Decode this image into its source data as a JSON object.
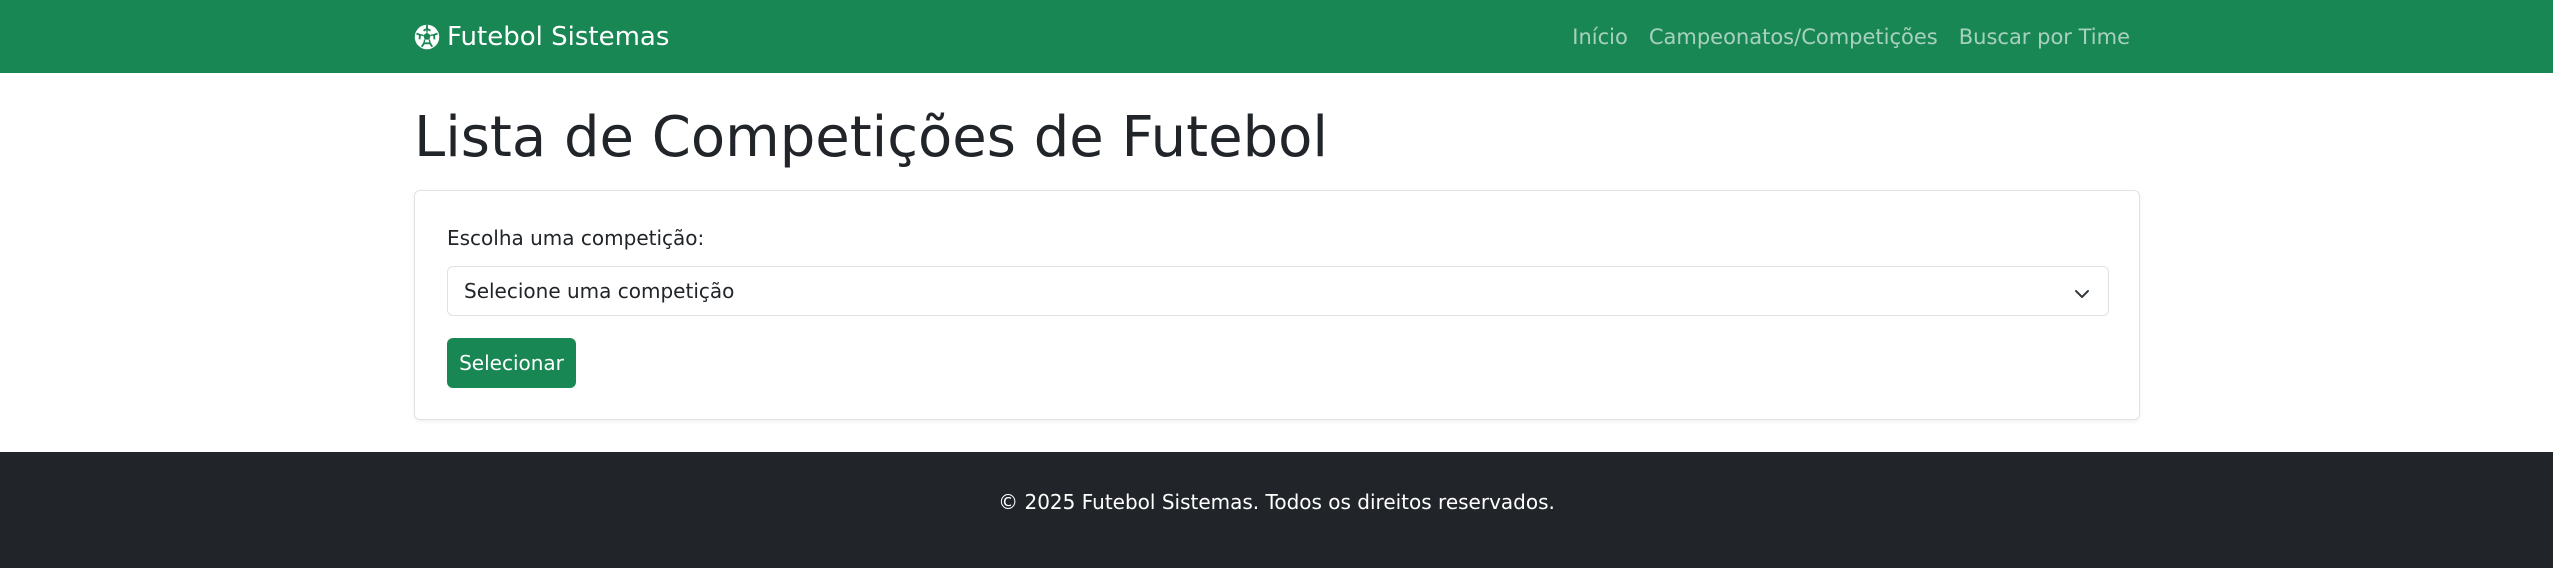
{
  "navbar": {
    "brand_icon": "soccer-ball-icon",
    "brand_label": "Futebol Sistemas",
    "links": [
      {
        "label": "Início"
      },
      {
        "label": "Campeonatos/Competições"
      },
      {
        "label": "Buscar por Time"
      }
    ],
    "background": "#198754"
  },
  "main": {
    "title": "Lista de Competições de Futebol",
    "form": {
      "label": "Escolha uma competição:",
      "select_value": "Selecione uma competição",
      "submit_label": "Selecionar"
    }
  },
  "footer": {
    "text": "© 2025 Futebol Sistemas. Todos os direitos reservados.",
    "background": "#212529"
  }
}
